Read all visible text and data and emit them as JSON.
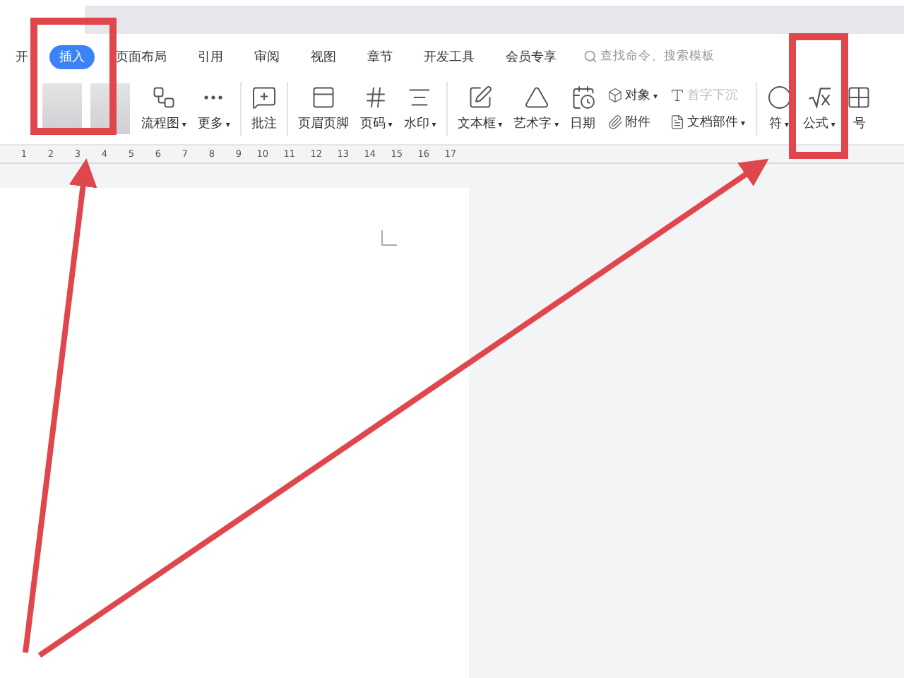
{
  "tabs": [
    {
      "label": "开",
      "selected": false
    },
    {
      "label": "插入",
      "selected": true
    },
    {
      "label": "页面布局",
      "selected": false
    },
    {
      "label": "引用",
      "selected": false
    },
    {
      "label": "审阅",
      "selected": false
    },
    {
      "label": "视图",
      "selected": false
    },
    {
      "label": "章节",
      "selected": false
    },
    {
      "label": "开发工具",
      "selected": false
    },
    {
      "label": "会员专享",
      "selected": false
    }
  ],
  "search": {
    "placeholder": "查找命令、搜索模板"
  },
  "tools": [
    {
      "kind": "blurred"
    },
    {
      "kind": "big",
      "label": "流程图",
      "caret": "▾"
    },
    {
      "kind": "big",
      "label": "更多",
      "caret": "▾"
    },
    {
      "kind": "sep"
    },
    {
      "kind": "big",
      "label": "批注"
    },
    {
      "kind": "sep"
    },
    {
      "kind": "big",
      "label": "页眉页脚"
    },
    {
      "kind": "big",
      "label": "页码",
      "caret": "▾"
    },
    {
      "kind": "big",
      "label": "水印",
      "caret": "▾"
    },
    {
      "kind": "sep"
    },
    {
      "kind": "big",
      "label": "文本框",
      "caret": "▾"
    },
    {
      "kind": "big",
      "label": "艺术字",
      "caret": "▾"
    },
    {
      "kind": "big",
      "label": "日期"
    },
    {
      "kind": "stack",
      "items": [
        {
          "label": "对象",
          "caret": "▾",
          "disabled": false
        },
        {
          "label": "附件",
          "disabled": false
        }
      ]
    },
    {
      "kind": "stack",
      "items": [
        {
          "label": "首字下沉",
          "disabled": true
        },
        {
          "label": "文档部件",
          "caret": "▾",
          "disabled": false
        }
      ]
    },
    {
      "kind": "sep"
    },
    {
      "kind": "big",
      "label": "符",
      "caret": "▾"
    },
    {
      "kind": "big",
      "label": "公式",
      "caret": "▾"
    },
    {
      "kind": "big",
      "label": "号"
    }
  ],
  "ruler": [
    "1",
    "2",
    "3",
    "4",
    "5",
    "6",
    "7",
    "8",
    "9",
    "10",
    "11",
    "12",
    "13",
    "14",
    "15",
    "16",
    "17"
  ],
  "annotations": [
    {
      "kind": "frame"
    },
    {
      "kind": "frame"
    },
    {
      "kind": "arrow"
    },
    {
      "kind": "arrow"
    }
  ]
}
